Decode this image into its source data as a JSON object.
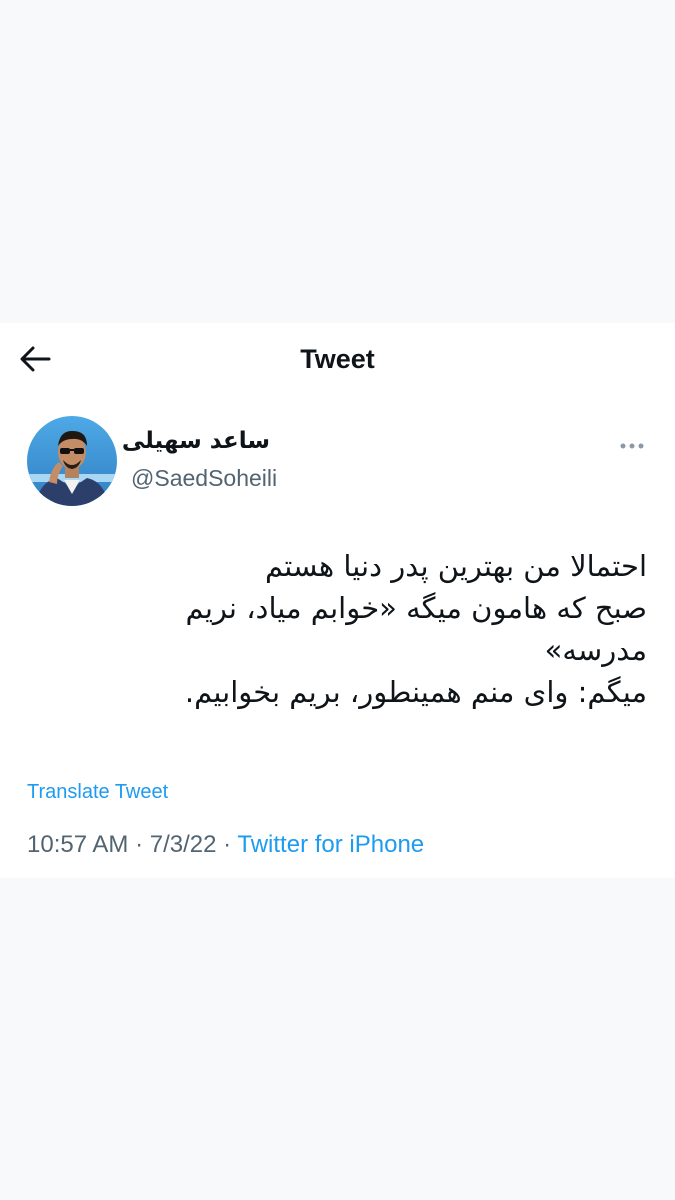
{
  "header": {
    "title": "Tweet",
    "back_icon": "arrow-left-icon"
  },
  "author": {
    "display_name": "ساعد سهیلی",
    "handle": "@SaedSoheili",
    "avatar": "avatar-photo"
  },
  "more_icon": "more-horizontal-icon",
  "tweet": {
    "lines": [
      "احتمالا من بهترین پدر دنیا هستم",
      "صبح که هامون میگه «خوابم میاد، نریم",
      "مدرسه»",
      "میگم: وای منم همینطور، بریم بخوابیم."
    ]
  },
  "translate_label": "Translate Tweet",
  "meta": {
    "time": "10:57 AM",
    "separator": "·",
    "date": "7/3/22",
    "source": "Twitter for iPhone"
  },
  "colors": {
    "accent": "#1d9bf0",
    "text": "#0f1419",
    "secondary": "#536471",
    "page_bg": "#f7f9fa"
  }
}
